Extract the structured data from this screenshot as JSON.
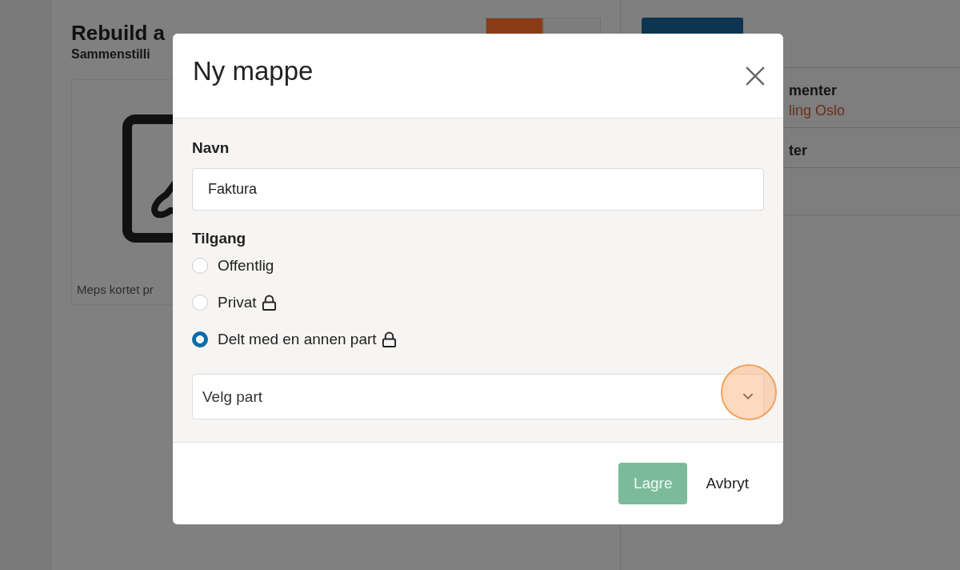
{
  "page": {
    "title": "Rebuild a",
    "subtitle": "Sammenstilli",
    "card_caption": "Meps kortet pr",
    "side_items": [
      {
        "title": "menter",
        "subtitle": "ling Oslo"
      },
      {
        "title": "ter"
      }
    ]
  },
  "dialog": {
    "title": "Ny mappe",
    "name_label": "Navn",
    "name_value": "Faktura",
    "access_label": "Tilgang",
    "options": [
      {
        "label": "Offentlig",
        "locked": false,
        "selected": false
      },
      {
        "label": "Privat",
        "locked": true,
        "selected": false
      },
      {
        "label": "Delt med en annen part",
        "locked": true,
        "selected": true
      }
    ],
    "party_select": {
      "placeholder": "Velg part"
    },
    "buttons": [
      {
        "label": "Lagre",
        "kind": "primary",
        "disabled": true
      },
      {
        "label": "Avbryt",
        "kind": "link",
        "disabled": false
      }
    ]
  }
}
